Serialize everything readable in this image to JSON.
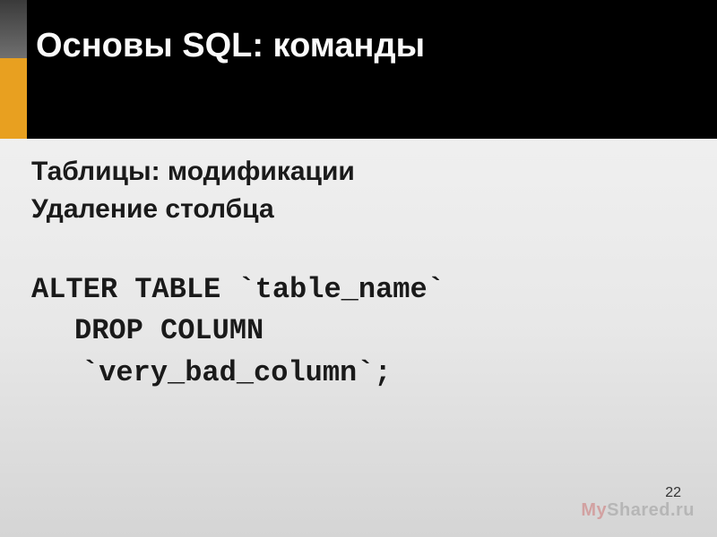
{
  "header": {
    "title": "Основы SQL: команды"
  },
  "content": {
    "subtitle1": "Таблицы: модификации",
    "subtitle2": "Удаление столбца",
    "code": {
      "line1": "ALTER TABLE `table_name`",
      "line2": "DROP COLUMN",
      "line3": "`very_bad_column`;"
    }
  },
  "footer": {
    "page_number": "22",
    "watermark_prefix": "My",
    "watermark_suffix": "Shared.ru"
  },
  "colors": {
    "accent": "#e8a020",
    "header_bg": "#000000"
  }
}
